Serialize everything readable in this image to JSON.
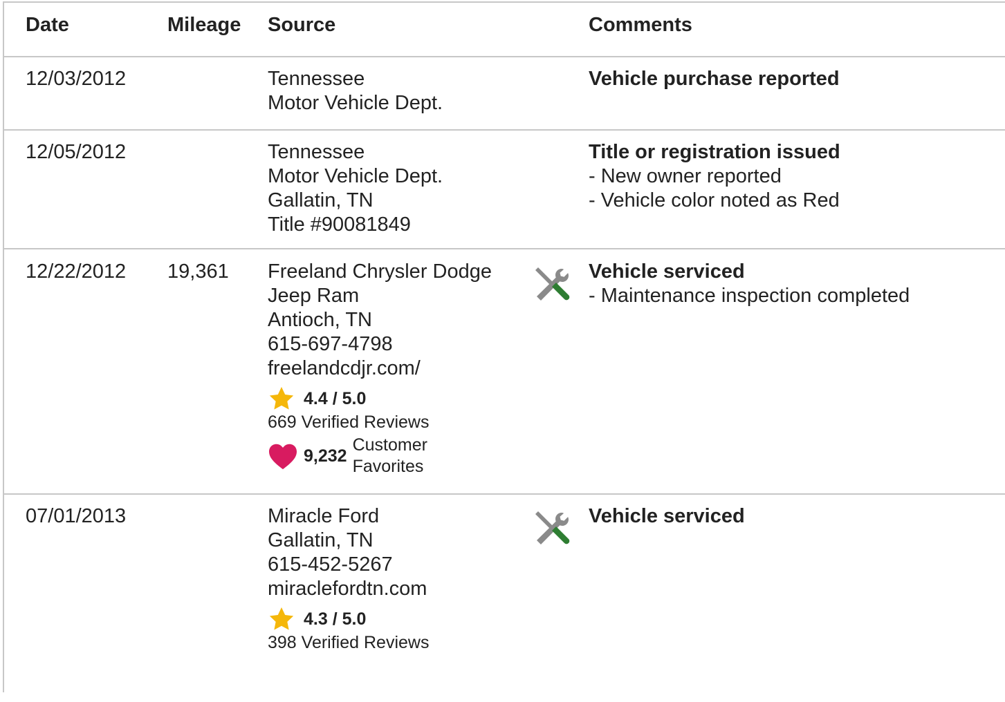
{
  "headers": {
    "date": "Date",
    "mileage": "Mileage",
    "source": "Source",
    "comments": "Comments"
  },
  "records": [
    {
      "date": "12/03/2012",
      "mileage": "",
      "source": [
        "Tennessee",
        "Motor Vehicle Dept."
      ],
      "comment_title": "Vehicle purchase reported",
      "comment_details": []
    },
    {
      "date": "12/05/2012",
      "mileage": "",
      "source": [
        "Tennessee",
        "Motor Vehicle Dept.",
        "Gallatin, TN",
        "Title #90081849"
      ],
      "comment_title": "Title or registration issued",
      "comment_details": [
        "- New owner reported",
        "- Vehicle color noted as Red"
      ]
    },
    {
      "date": "12/22/2012",
      "mileage": "19,361",
      "source": [
        "Freeland Chrysler Dodge",
        "Jeep Ram",
        "Antioch, TN",
        "615-697-4798",
        "freelandcdjr.com/"
      ],
      "rating": "4.4 / 5.0",
      "rating_value": 4.4,
      "rating_max": 5.0,
      "reviews": "669 Verified Reviews",
      "favorites_count": "9,232",
      "favorites_label_line1": "Customer",
      "favorites_label_line2": "Favorites",
      "icon": "service-tools-icon",
      "comment_title": "Vehicle serviced",
      "comment_details": [
        "- Maintenance inspection completed"
      ]
    },
    {
      "date": "07/01/2013",
      "mileage": "",
      "source": [
        "Miracle Ford",
        "Gallatin, TN",
        "615-452-5267",
        "miraclefordtn.com"
      ],
      "rating": "4.3 / 5.0",
      "rating_value": 4.3,
      "rating_max": 5.0,
      "reviews": "398 Verified Reviews",
      "icon": "service-tools-icon",
      "comment_title": "Vehicle serviced",
      "comment_details": []
    }
  ],
  "colors": {
    "border": "#c7c7c7",
    "text": "#222222",
    "star": "#f5b70a",
    "heart": "#d81b60",
    "tool_gray": "#8a8a8a",
    "tool_green": "#2e7d32"
  }
}
